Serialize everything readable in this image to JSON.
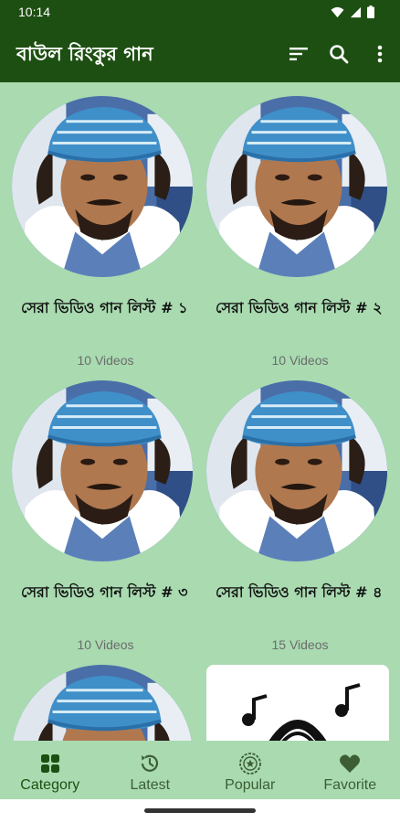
{
  "status_bar": {
    "time": "10:14"
  },
  "app_bar": {
    "title": "বাউল রিংকুর গান",
    "actions": [
      "sort-icon",
      "search-icon",
      "more-vert-icon"
    ]
  },
  "colors": {
    "primary": "#1d4f12",
    "background": "#a9dab0",
    "muted_text": "#6c6c6c"
  },
  "playlists": [
    {
      "title": "সেরা ভিডিও গান লিস্ট # ১",
      "count": "10 Videos"
    },
    {
      "title": "সেরা ভিডিও গান লিস্ট # ২",
      "count": "10 Videos"
    },
    {
      "title": "সেরা ভিডিও গান লিস্ট # ৩",
      "count": "10 Videos"
    },
    {
      "title": "সেরা ভিডিও গান লিস্ট # ৪",
      "count": "15 Videos"
    }
  ],
  "bottom_nav": [
    {
      "label": "Category",
      "icon": "grid-icon",
      "active": true
    },
    {
      "label": "Latest",
      "icon": "history-icon",
      "active": false
    },
    {
      "label": "Popular",
      "icon": "badge-star-icon",
      "active": false
    },
    {
      "label": "Favorite",
      "icon": "heart-icon",
      "active": false
    }
  ]
}
